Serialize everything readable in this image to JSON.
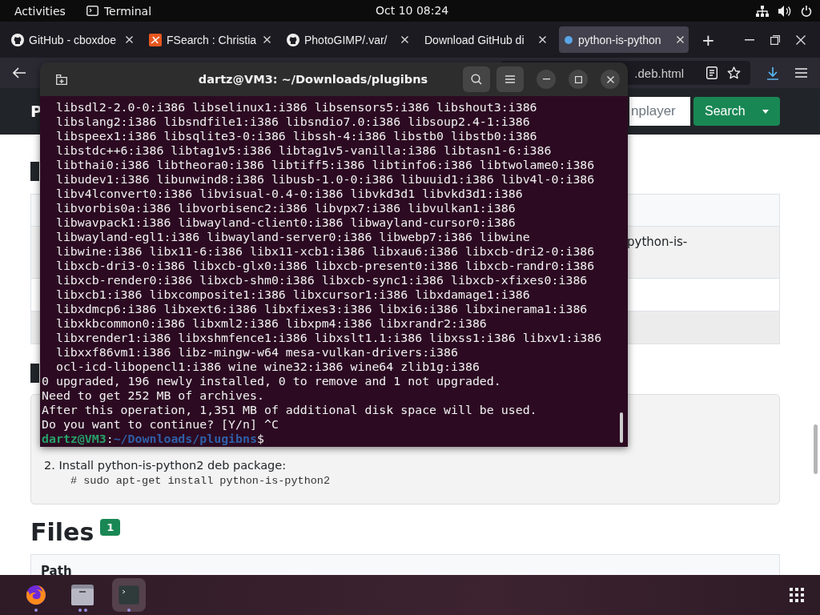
{
  "top_bar": {
    "activities": "Activities",
    "app": "Terminal",
    "clock": "Oct 10  08:24"
  },
  "browser": {
    "tabs": [
      {
        "title": "GitHub - cboxdoe",
        "kind": "github",
        "selected": false
      },
      {
        "title": "FSearch : Christia",
        "kind": "fsearch",
        "selected": false
      },
      {
        "title": "PhotoGIMP/.var/",
        "kind": "github",
        "selected": false
      },
      {
        "title": "Download GitHub di",
        "kind": "plain",
        "selected": false
      },
      {
        "title": "python-is-python",
        "kind": "dot",
        "selected": true
      }
    ],
    "new_tab": "+",
    "url": ".deb.html"
  },
  "page": {
    "brand": "P",
    "search": {
      "value": "nplayer"
    },
    "search_button": "Search",
    "table_cell": "python-is-",
    "instructions": {
      "step": "2. Install python-is-python2 deb package:",
      "command": "# sudo apt-get install python-is-python2"
    },
    "files_heading": "Files",
    "files_count": "1",
    "files_table": {
      "columns": [
        "Path"
      ]
    }
  },
  "terminal": {
    "title": "dartz@VM3: ~/Downloads/plugibns",
    "lines": [
      "  libsdl2-2.0-0:i386 libselinux1:i386 libsensors5:i386 libshout3:i386",
      "  libslang2:i386 libsndfile1:i386 libsndio7.0:i386 libsoup2.4-1:i386",
      "  libspeex1:i386 libsqlite3-0:i386 libssh-4:i386 libstb0 libstb0:i386",
      "  libstdc++6:i386 libtag1v5:i386 libtag1v5-vanilla:i386 libtasn1-6:i386",
      "  libthai0:i386 libtheora0:i386 libtiff5:i386 libtinfo6:i386 libtwolame0:i386",
      "  libudev1:i386 libunwind8:i386 libusb-1.0-0:i386 libuuid1:i386 libv4l-0:i386",
      "  libv4lconvert0:i386 libvisual-0.4-0:i386 libvkd3d1 libvkd3d1:i386",
      "  libvorbis0a:i386 libvorbisenc2:i386 libvpx7:i386 libvulkan1:i386",
      "  libwavpack1:i386 libwayland-client0:i386 libwayland-cursor0:i386",
      "  libwayland-egl1:i386 libwayland-server0:i386 libwebp7:i386 libwine",
      "  libwine:i386 libx11-6:i386 libx11-xcb1:i386 libxau6:i386 libxcb-dri2-0:i386",
      "  libxcb-dri3-0:i386 libxcb-glx0:i386 libxcb-present0:i386 libxcb-randr0:i386",
      "  libxcb-render0:i386 libxcb-shm0:i386 libxcb-sync1:i386 libxcb-xfixes0:i386",
      "  libxcb1:i386 libxcomposite1:i386 libxcursor1:i386 libxdamage1:i386",
      "  libxdmcp6:i386 libxext6:i386 libxfixes3:i386 libxi6:i386 libxinerama1:i386",
      "  libxkbcommon0:i386 libxml2:i386 libxpm4:i386 libxrandr2:i386",
      "  libxrender1:i386 libxshmfence1:i386 libxslt1.1:i386 libxss1:i386 libxv1:i386",
      "  libxxf86vm1:i386 libz-mingw-w64 mesa-vulkan-drivers:i386",
      "  ocl-icd-libopencl1:i386 wine wine32:i386 wine64 zlib1g:i386",
      "0 upgraded, 196 newly installed, 0 to remove and 1 not upgraded.",
      "Need to get 252 MB of archives.",
      "After this operation, 1,351 MB of additional disk space will be used.",
      "Do you want to continue? [Y/n] ^C"
    ],
    "prompt": {
      "user": "dartz@VM3",
      "separator": ":",
      "path": "~/Downloads/plugibns",
      "symbol": "$"
    }
  },
  "dock": {
    "apps": [
      {
        "kind": "firefox",
        "running": true,
        "selected": false
      },
      {
        "kind": "files",
        "running": true,
        "selected": false
      },
      {
        "kind": "terminal",
        "running": true,
        "selected": true
      }
    ]
  }
}
